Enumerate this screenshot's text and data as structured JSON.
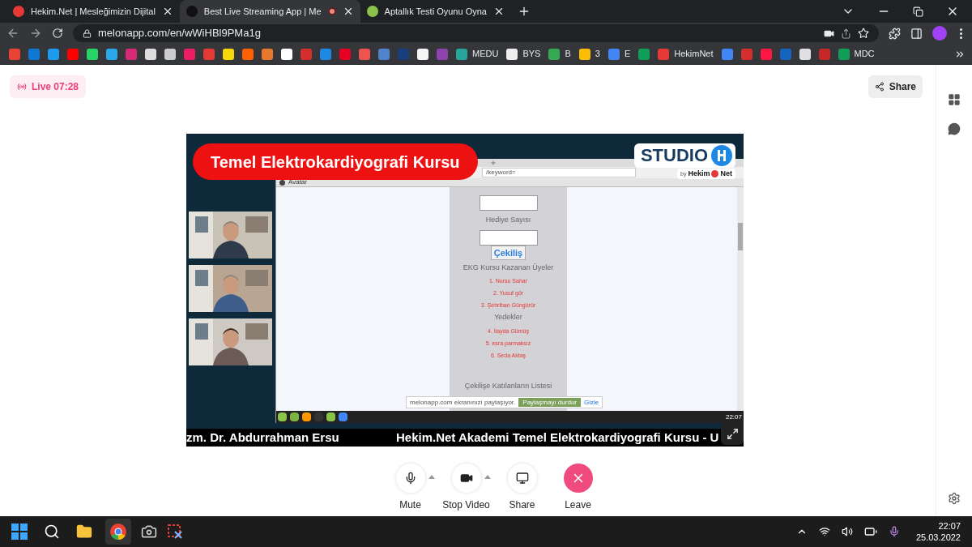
{
  "browser": {
    "tabs": [
      {
        "title": "Hekim.Net | Mesleğimizin Dijital",
        "selected": false,
        "color": "#e53935",
        "recording": false
      },
      {
        "title": "Best Live Streaming App | Me",
        "selected": true,
        "color": "#111111",
        "recording": true
      },
      {
        "title": "Aptallık Testi Oyunu Oyna",
        "selected": false,
        "color": "#8bc34a",
        "recording": false
      }
    ],
    "url": "melonapp.com/en/wWiHBl9PMa1g",
    "bookmarks": [
      {
        "color": "#ea4335"
      },
      {
        "color": "#0f78d4"
      },
      {
        "color": "#1d9bf0"
      },
      {
        "color": "#ff0000"
      },
      {
        "color": "#25d366"
      },
      {
        "color": "#29a9eb"
      },
      {
        "color": "#d62976"
      },
      {
        "color": "#dddddd"
      },
      {
        "color": "#cccccc"
      },
      {
        "color": "#e91e63"
      },
      {
        "color": "#e53935"
      },
      {
        "color": "#f5d90a"
      },
      {
        "color": "#ff6000"
      },
      {
        "color": "#e8772e"
      },
      {
        "color": "#ffffff"
      },
      {
        "color": "#d32f2f"
      },
      {
        "color": "#1e88e5"
      },
      {
        "color": "#e60023"
      },
      {
        "color": "#ef5350"
      },
      {
        "color": "#4f83cc"
      },
      {
        "color": "#1a3d7c"
      },
      {
        "color": "#f5f5f5"
      },
      {
        "color": "#8e44ad"
      },
      {
        "color": "#26a69a",
        "label": "MEDU"
      },
      {
        "color": "#eeeeee",
        "label": "BYS"
      },
      {
        "color": "#34a853",
        "label": "B"
      },
      {
        "color": "#fbbc04",
        "label": "3"
      },
      {
        "color": "#4285f4",
        "label": "E"
      },
      {
        "color": "#0f9d58"
      },
      {
        "color": "#e53935",
        "label": "HekimNet"
      },
      {
        "color": "#4285f4"
      },
      {
        "color": "#d32f2f"
      },
      {
        "color": "#ff1744"
      },
      {
        "color": "#1565c0"
      },
      {
        "color": "#e0e0e0"
      },
      {
        "color": "#c62828"
      },
      {
        "color": "#0f9d58",
        "label": "MDC"
      }
    ]
  },
  "meeting": {
    "live_badge": "Live 07:28",
    "share_button": "Share",
    "stream": {
      "title_banner": "Temel Elektrokardiyografi Kursu",
      "logo": {
        "word": "STUDIO",
        "byline": "by",
        "brand": "Hekim",
        "brand_suffix": "Net"
      },
      "participants": [
        {
          "kind": "picture"
        },
        {
          "kind": "picture"
        },
        {
          "kind": "picture"
        }
      ],
      "shared_screen": {
        "url_fragment": "/keyword=",
        "bookmark": "Avatar",
        "field_label": "Hediye Sayısı",
        "draw_button": "Çekiliş",
        "winners_heading": "EKG Kursu Kazanan Üyeler",
        "winners": [
          "1. Nursu Sahar",
          "2. Yusuf gör",
          "3. Şehriban Güngürür"
        ],
        "reserves_heading": "Yedekler",
        "reserves": [
          "4. İlayda Gümüş",
          "5. esra parmaksız",
          "6. Seda Aktaş"
        ],
        "list_heading": "Çekilişe Katılanların Listesi",
        "share_notice": {
          "text": "melonapp.com ekranınızı paylaşıyor.",
          "stop_button": "Paylaşmayı durdur",
          "hide_link": "Gizle"
        },
        "clock": "22:07"
      },
      "ticker": [
        "zm. Dr. Abdurrahman Ersu",
        "Hekim.Net Akademi Temel Elektrokardiyografi Kursu - U"
      ]
    },
    "controls": [
      {
        "kind": "mic",
        "label": "Mute"
      },
      {
        "kind": "video",
        "label": "Stop Video"
      },
      {
        "kind": "share",
        "label": "Share"
      },
      {
        "kind": "leave",
        "label": "Leave"
      }
    ]
  },
  "taskbar": {
    "time": "22:07",
    "date": "25.03.2022"
  }
}
